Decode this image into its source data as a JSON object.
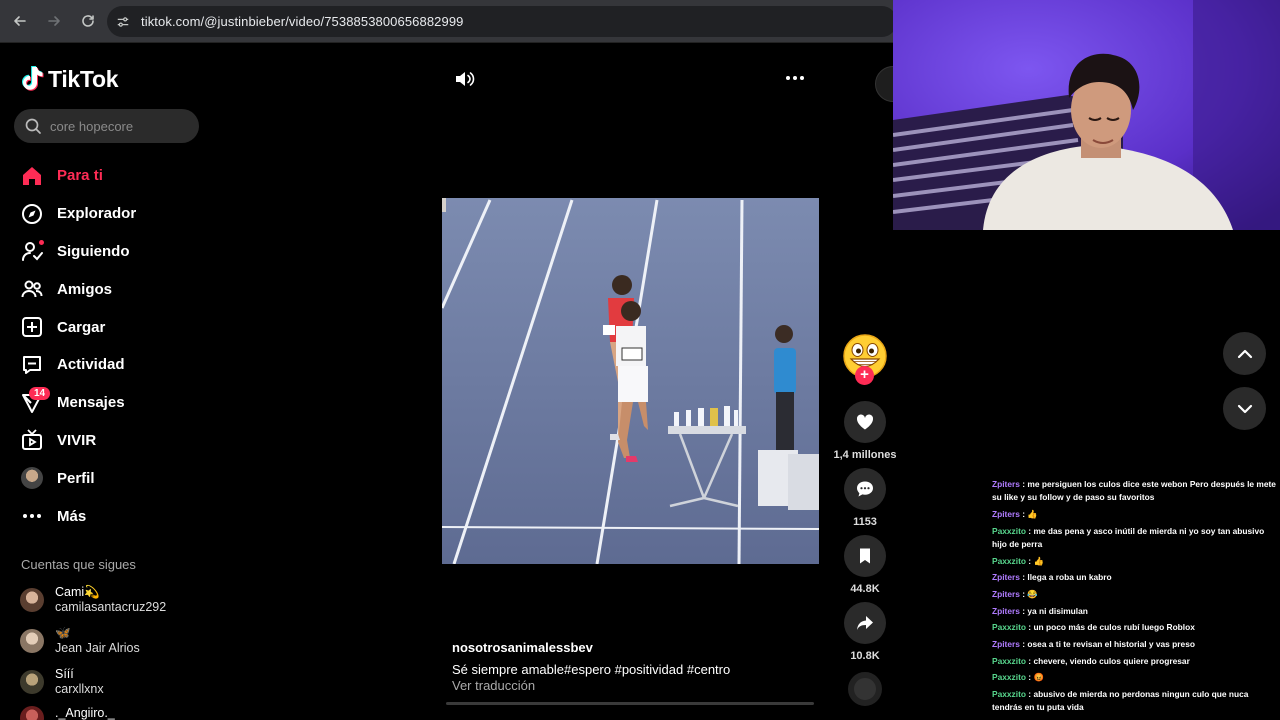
{
  "browser": {
    "url": "tiktok.com/@justinbieber/video/7538853800656882999"
  },
  "sidebar": {
    "logo_text": "TikTok",
    "search_placeholder": "core hopecore",
    "nav": [
      {
        "label": "Para ti",
        "icon": "home-icon",
        "active": true
      },
      {
        "label": "Explorador",
        "icon": "compass-icon"
      },
      {
        "label": "Siguiendo",
        "icon": "following-icon"
      },
      {
        "label": "Amigos",
        "icon": "friends-icon"
      },
      {
        "label": "Cargar",
        "icon": "upload-icon"
      },
      {
        "label": "Actividad",
        "icon": "activity-icon"
      },
      {
        "label": "Mensajes",
        "icon": "messages-icon",
        "badge": "14"
      },
      {
        "label": "VIVIR",
        "icon": "live-icon"
      },
      {
        "label": "Perfil",
        "icon": "avatar"
      },
      {
        "label": "Más",
        "icon": "more-icon"
      }
    ],
    "following_title": "Cuentas que sigues",
    "following": [
      {
        "name": "Cami💫",
        "user": "camilasantacruz292",
        "color": "#7a5a48"
      },
      {
        "name": "🦋",
        "user": "Jean Jair Alrios",
        "color": "#9a8270"
      },
      {
        "name": "Sííí",
        "user": "carxllxnx",
        "color": "#4d4a3a"
      },
      {
        "name": "._Angiiro._",
        "user": "",
        "color": "#8a2a2a"
      }
    ]
  },
  "video": {
    "username": "nosotrosanimalessbev",
    "description": "Sé siempre amable#espero  #positividad  #centro",
    "translate": "Ver traducción"
  },
  "actions": {
    "likes": "1,4 millones",
    "comments": "1153",
    "saves": "44.8K",
    "shares": "10.8K"
  },
  "chat": [
    {
      "user": "Zpiters",
      "color": "#b07cff",
      "text": "me persiguen los culos dice este webon Pero después le mete su like y su follow y de paso su favoritos"
    },
    {
      "user": "Zpiters",
      "color": "#b07cff",
      "text": "👍"
    },
    {
      "user": "Paxxzito",
      "color": "#58d68d",
      "text": "me das pena y asco inútil de mierda ni yo soy tan abusivo hijo de perra"
    },
    {
      "user": "Paxxzito",
      "color": "#58d68d",
      "text": "👍"
    },
    {
      "user": "Zpiters",
      "color": "#b07cff",
      "text": "llega a roba un kabro"
    },
    {
      "user": "Zpiters",
      "color": "#b07cff",
      "text": "😂"
    },
    {
      "user": "Zpiters",
      "color": "#b07cff",
      "text": "ya ni disimulan"
    },
    {
      "user": "Paxxzito",
      "color": "#58d68d",
      "text": "un poco más de culos rubí luego Roblox"
    },
    {
      "user": "Zpiters",
      "color": "#b07cff",
      "text": "osea a ti te revisan el historial y vas preso"
    },
    {
      "user": "Paxxzito",
      "color": "#58d68d",
      "text": "chevere, viendo culos quiere progresar"
    },
    {
      "user": "Paxxzito",
      "color": "#58d68d",
      "text": "😡"
    },
    {
      "user": "Paxxzito",
      "color": "#58d68d",
      "text": "abusivo de mierda no perdonas ningun culo que nuca tendrás en tu puta vida"
    }
  ]
}
